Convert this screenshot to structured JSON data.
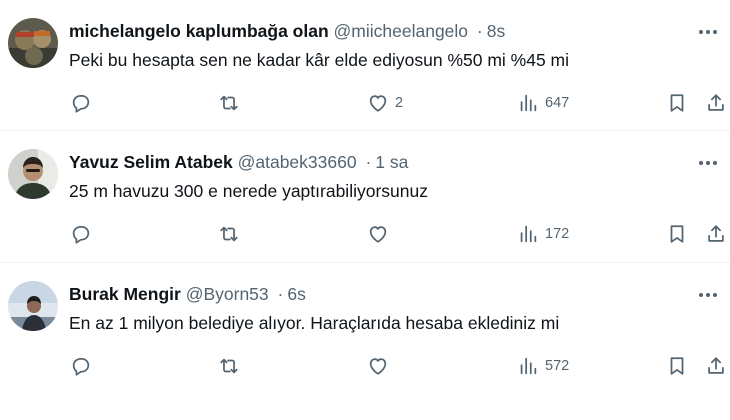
{
  "tweets": [
    {
      "name": "michelangelo kaplumbağa olan",
      "handle": "@miicheelangelo",
      "separator": "·",
      "time": "8s",
      "text": "Peki bu hesapta sen ne kadar kâr elde ediyosun %50 mi %45 mi",
      "likes": "2",
      "views": "647"
    },
    {
      "name": "Yavuz Selim Atabek",
      "handle": "@atabek33660",
      "separator": "·",
      "time": "1 sa",
      "text": "25 m havuzu 300 e nerede yaptırabiliyorsunuz",
      "likes": "",
      "views": "172"
    },
    {
      "name": "Burak Mengir",
      "handle": "@Byorn53",
      "separator": "·",
      "time": "6s",
      "text": "En az 1 milyon belediye alıyor. Haraçlarıda hesaba eklediniz mi",
      "likes": "",
      "views": "572"
    }
  ],
  "icons": {
    "reply": "reply-icon",
    "retweet": "retweet-icon",
    "like": "heart-icon",
    "views": "views-icon",
    "bookmark": "bookmark-icon",
    "share": "share-icon",
    "more": "more-icon"
  },
  "colors": {
    "text_primary": "#0f1419",
    "text_secondary": "#536471",
    "divider": "#eff3f4"
  }
}
